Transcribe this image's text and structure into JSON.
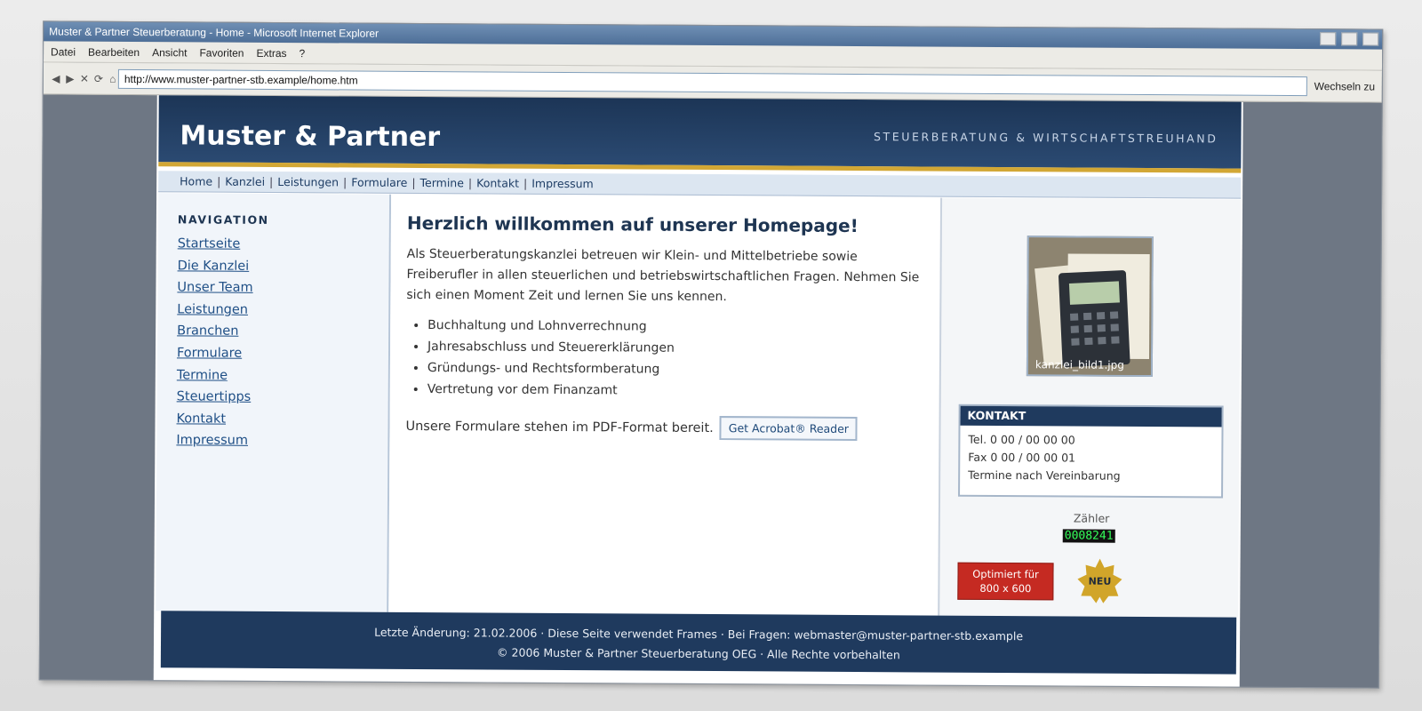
{
  "browser": {
    "title": "Muster & Partner Steuerberatung - Home - Microsoft Internet Explorer",
    "menu": [
      "Datei",
      "Bearbeiten",
      "Ansicht",
      "Favoriten",
      "Extras",
      "?"
    ],
    "url": "http://www.muster-partner-stb.example/home.htm",
    "go_label": "Wechseln zu",
    "nav_icons": [
      "back-icon",
      "forward-icon",
      "stop-icon",
      "refresh-icon",
      "home-icon"
    ]
  },
  "header": {
    "title": "Muster & Partner",
    "tagline": "STEUERBERATUNG & WIRTSCHAFTSTREUHAND"
  },
  "topnav": [
    "Home",
    "Kanzlei",
    "Leistungen",
    "Formulare",
    "Termine",
    "Kontakt",
    "Impressum"
  ],
  "sidebar": {
    "heading": "NAVIGATION",
    "items": [
      "Startseite",
      "Die Kanzlei",
      "Unser Team",
      "Leistungen",
      "Branchen",
      "Formulare",
      "Termine",
      "Steuertipps",
      "Kontakt",
      "Impressum"
    ]
  },
  "main": {
    "title": "Herzlich willkommen auf unserer Homepage!",
    "intro": "Als Steuerberatungskanzlei betreuen wir Klein- und Mittelbetriebe sowie Freiberufler in allen steuerlichen und betriebswirtschaftlichen Fragen. Nehmen Sie sich einen Moment Zeit und lernen Sie uns kennen.",
    "services": [
      "Buchhaltung und Lohnverrechnung",
      "Jahresabschluss und Steuererklärungen",
      "Gründungs- und Rechtsformberatung",
      "Vertretung vor dem Finanzamt"
    ],
    "pdf_text": "Unsere Formulare stehen im PDF-Format bereit.",
    "acrobat_label": "Get Acrobat® Reader"
  },
  "right": {
    "photo_caption": "kanzlei_bild1.jpg",
    "kontakt_title": "KONTAKT",
    "tel": "Tel. 0 00 / 00 00 00",
    "fax": "Fax 0 00 / 00 00 01",
    "hours": "Termine nach Vereinbarung",
    "counter_label": "Zähler",
    "counter_value": "0008241",
    "optimiert_line1": "Optimiert für",
    "optimiert_line2": "800 x 600",
    "neu_label": "NEU"
  },
  "footer": {
    "line1": "Letzte Änderung: 21.02.2006  ·  Diese Seite verwendet Frames  ·  Bei Fragen: webmaster@muster-partner-stb.example",
    "line2": "© 2006 Muster & Partner Steuerberatung OEG  ·  Alle Rechte vorbehalten"
  },
  "colors": {
    "header_bg": "#1c3556",
    "accent_gold": "#d2a735",
    "link": "#1f4f86",
    "counter_text": "#34ff5a",
    "badge_red": "#c52a22"
  }
}
